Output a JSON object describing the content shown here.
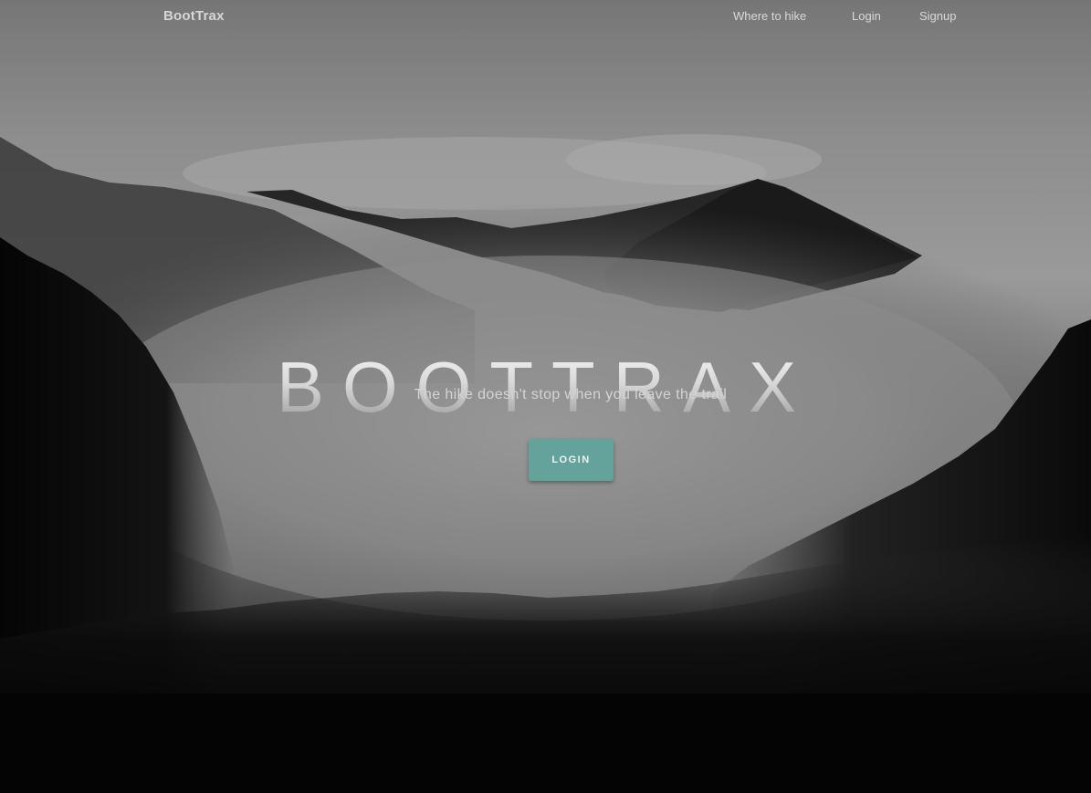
{
  "navbar": {
    "brand": "BootTrax",
    "links": [
      {
        "label": "Where to hike"
      },
      {
        "label": "Login"
      },
      {
        "label": "Signup"
      }
    ]
  },
  "hero": {
    "title": "BOOTTRAX",
    "subtitle": "The hike doesn't stop when you leave the trail",
    "cta_label": "LOGIN"
  },
  "colors": {
    "accent": "#63a39b",
    "nav_text": "#d9d9d9",
    "sky": "#8c8c8c",
    "forest": "#0a0a0a"
  }
}
